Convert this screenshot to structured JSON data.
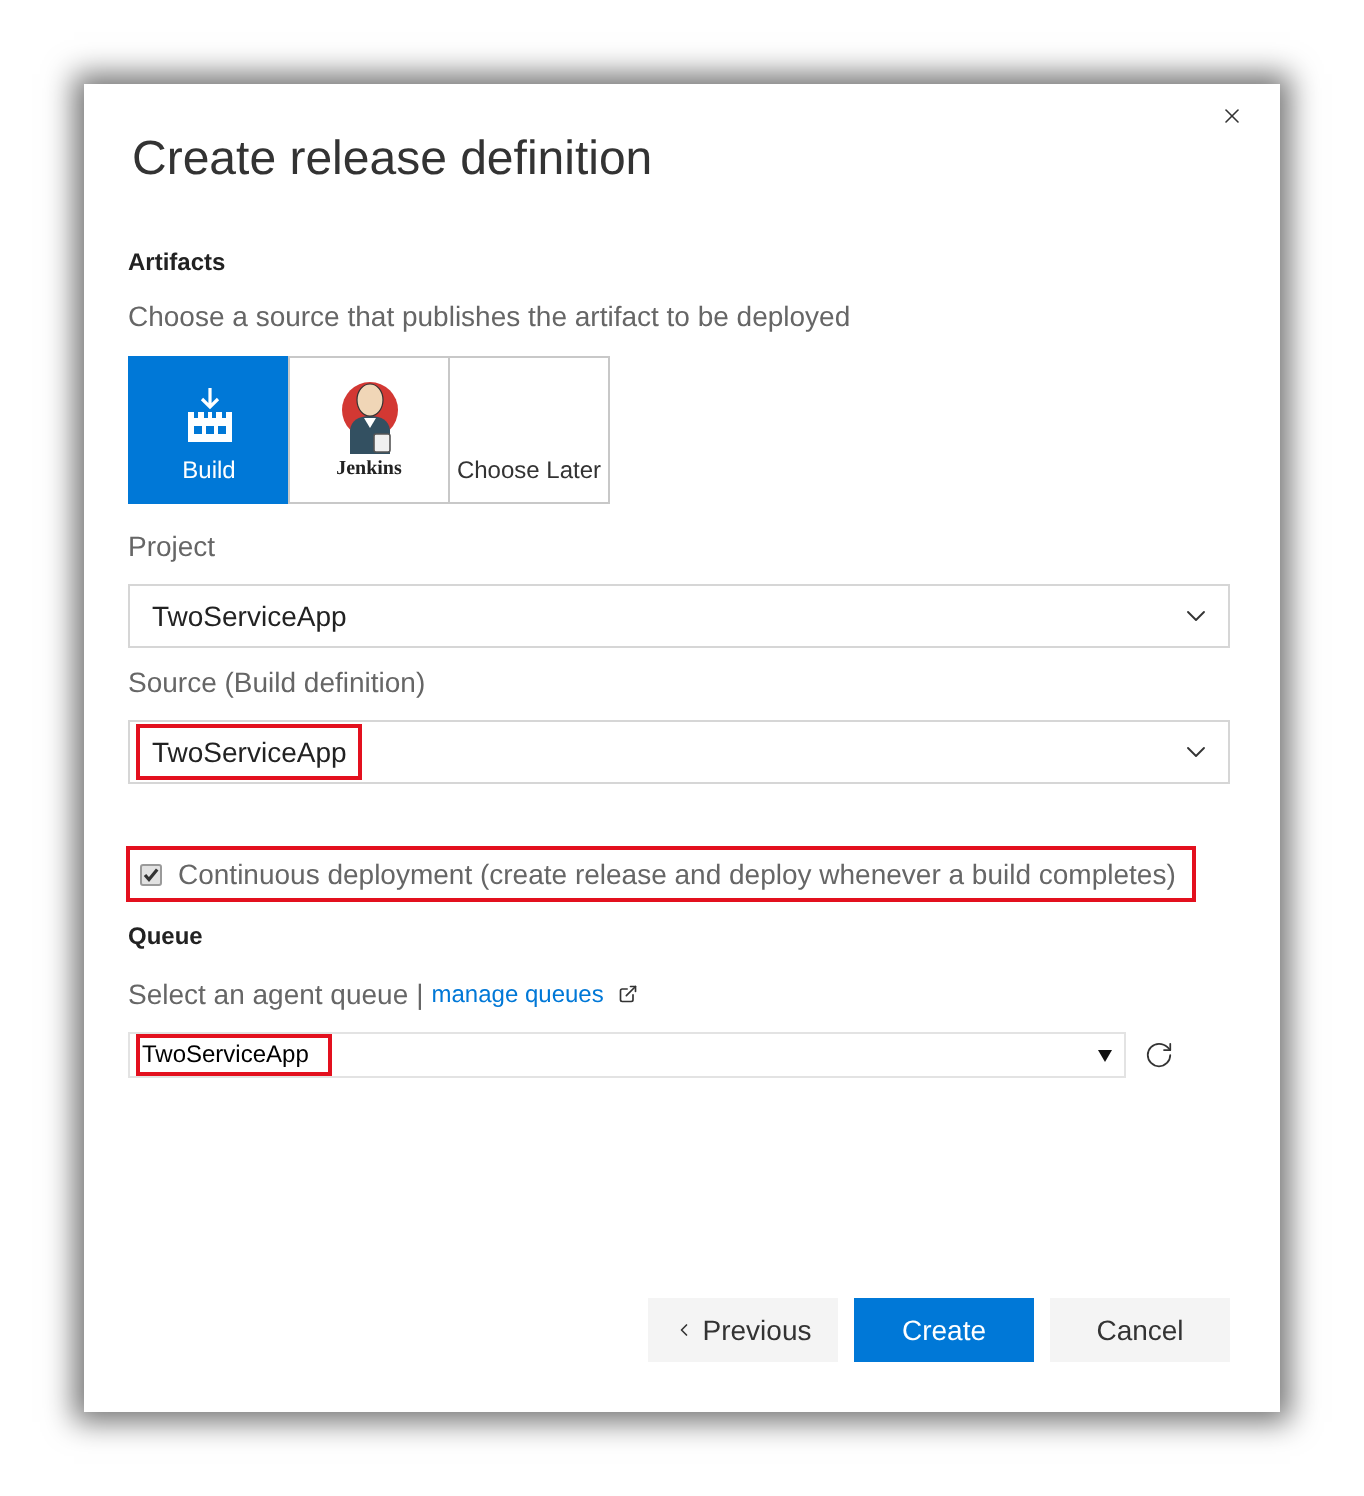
{
  "title": "Create release definition",
  "artifacts": {
    "heading": "Artifacts",
    "hint": "Choose a source that publishes the artifact to be deployed",
    "sources": [
      {
        "kind": "build",
        "label": "Build",
        "selected": true
      },
      {
        "kind": "jenkins",
        "label": "Jenkins",
        "selected": false
      },
      {
        "kind": "later",
        "label": "Choose Later",
        "selected": false
      }
    ]
  },
  "project": {
    "label": "Project",
    "value": "TwoServiceApp",
    "highlighted": false
  },
  "source": {
    "label": "Source (Build definition)",
    "value": "TwoServiceApp",
    "highlighted": true
  },
  "continuous_deployment": {
    "label": "Continuous deployment (create release and deploy whenever a build completes)",
    "checked": true,
    "highlighted": true
  },
  "queue": {
    "heading": "Queue",
    "hint": "Select an agent queue",
    "separator": "|",
    "link": "manage queues",
    "value": "TwoServiceApp",
    "highlighted": true
  },
  "buttons": [
    {
      "kind": "previous",
      "label": "Previous"
    },
    {
      "kind": "primary",
      "label": "Create"
    },
    {
      "kind": "secondary",
      "label": "Cancel"
    }
  ]
}
